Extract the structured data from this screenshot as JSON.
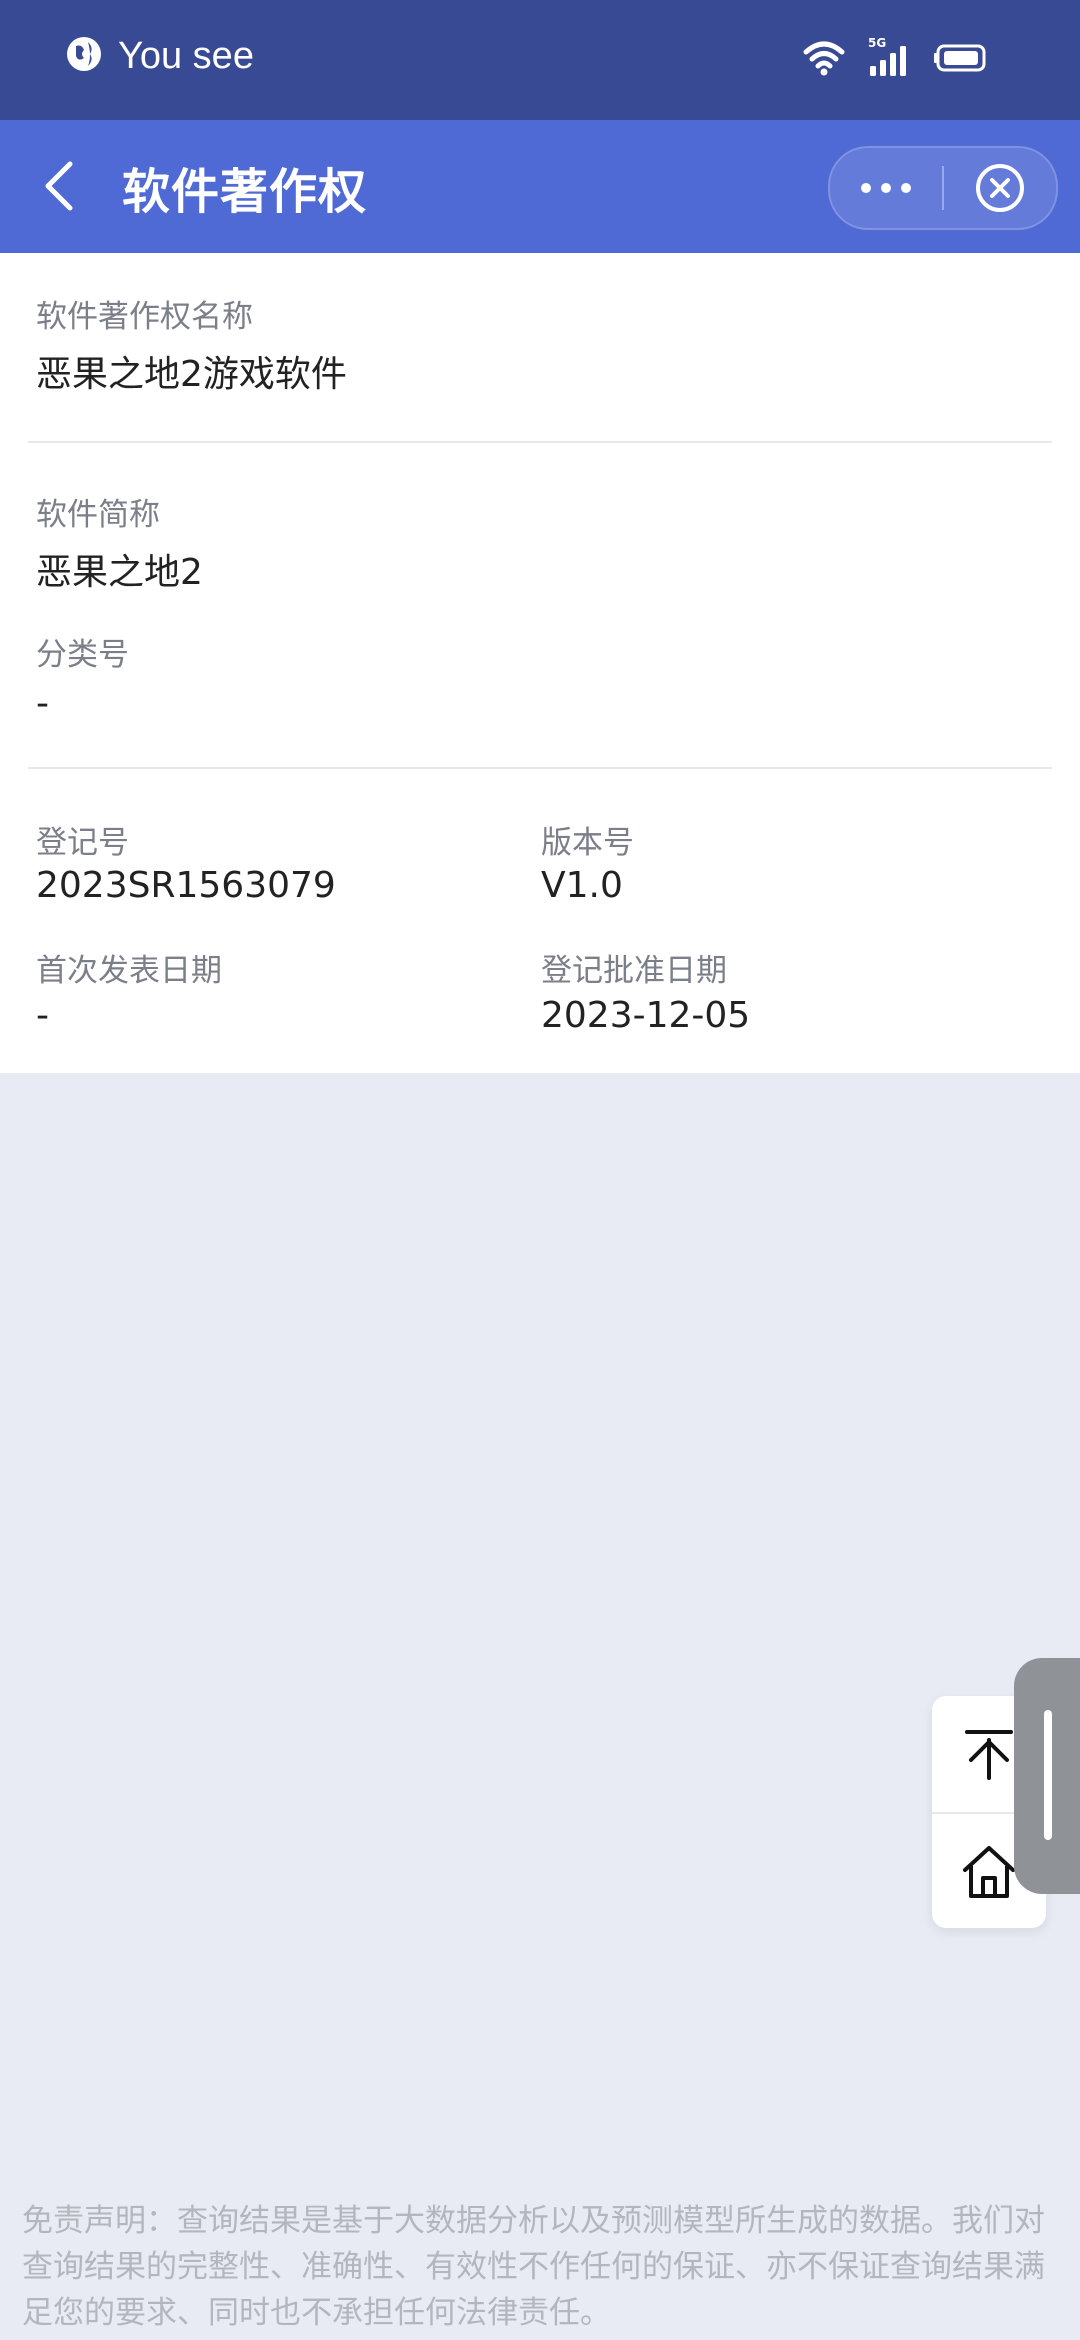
{
  "status_bar": {
    "app_name": "You see",
    "network": "5G"
  },
  "header": {
    "title": "软件著作权"
  },
  "fields": {
    "software_name_label": "软件著作权名称",
    "software_name_value": "恶果之地2游戏软件",
    "short_name_label": "软件简称",
    "short_name_value": "恶果之地2",
    "category_label": "分类号",
    "category_value": "-",
    "reg_no_label": "登记号",
    "reg_no_value": "2023SR1563079",
    "version_label": "版本号",
    "version_value": "V1.0",
    "first_pub_label": "首次发表日期",
    "first_pub_value": "-",
    "approval_label": "登记批准日期",
    "approval_value": "2023-12-05"
  },
  "disclaimer": "免责声明：查询结果是基于大数据分析以及预测模型所生成的数据。我们对查询结果的完整性、准确性、有效性不作任何的保证、亦不保证查询结果满足您的要求、同时也不承担任何法律责任。",
  "colors": {
    "status_bar": "#394a94",
    "header": "#4f69d5",
    "background": "#e8ebf3"
  }
}
